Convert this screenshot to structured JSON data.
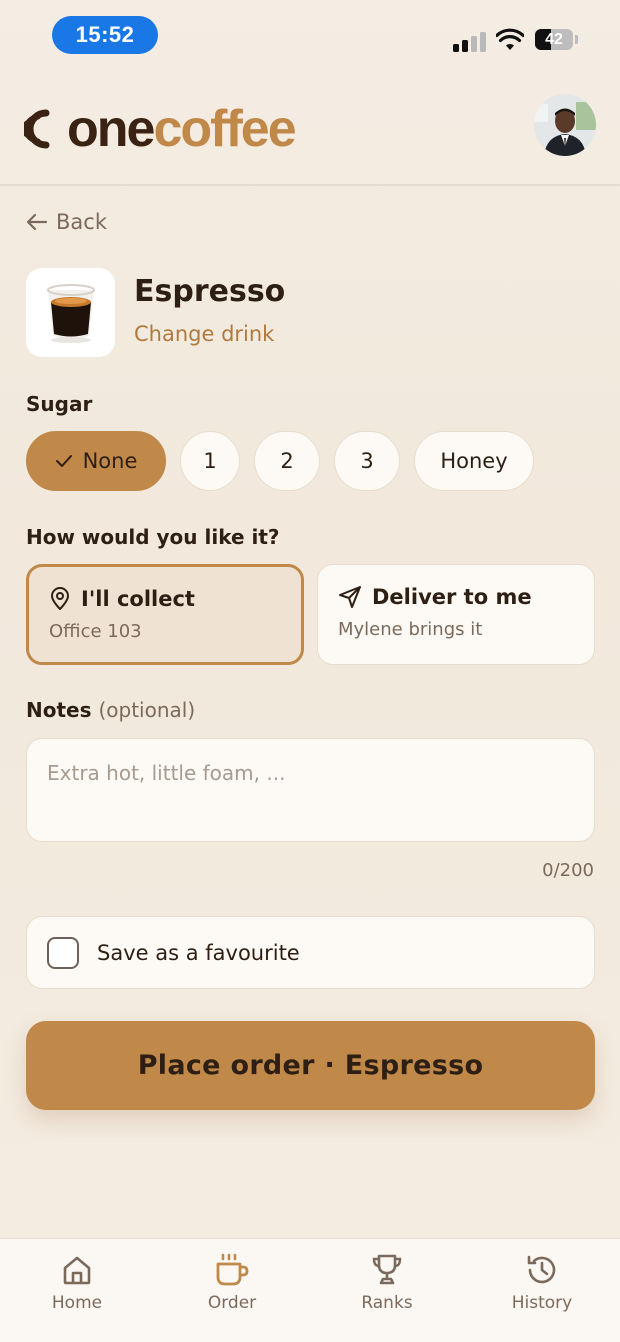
{
  "status_bar": {
    "time": "15:52",
    "battery_level": "42",
    "battery_fraction": 0.42
  },
  "header": {
    "logo_part1": "one",
    "logo_part2": "coffee",
    "avatar": "profile-photo"
  },
  "nav": {
    "back_label": "Back"
  },
  "drink": {
    "name": "Espresso",
    "change_label": "Change drink"
  },
  "sugar": {
    "label": "Sugar",
    "options": [
      "None",
      "1",
      "2",
      "3",
      "Honey"
    ],
    "selected": "None"
  },
  "delivery": {
    "label": "How would you like it?",
    "options": [
      {
        "title": "I'll collect",
        "subtitle": "Office 103",
        "icon": "location-pin-icon",
        "selected": true
      },
      {
        "title": "Deliver to me",
        "subtitle": "Mylene brings it",
        "icon": "send-icon",
        "selected": false
      }
    ]
  },
  "notes": {
    "label": "Notes",
    "optional": "(optional)",
    "placeholder": "Extra hot, little foam, ...",
    "counter": "0/200"
  },
  "favourite": {
    "label": "Save as a favourite",
    "checked": false
  },
  "place_order_label": "Place order · Espresso",
  "tabbar": {
    "items": [
      {
        "label": "Home",
        "icon": "home-icon"
      },
      {
        "label": "Order",
        "icon": "coffee-cup-icon"
      },
      {
        "label": "Ranks",
        "icon": "trophy-icon"
      },
      {
        "label": "History",
        "icon": "history-icon"
      }
    ],
    "active": "Order"
  },
  "colors": {
    "accent": "#c08849",
    "brand_dark": "#3b2314",
    "background": "#f3ebe0",
    "card": "#fdfaf5"
  }
}
